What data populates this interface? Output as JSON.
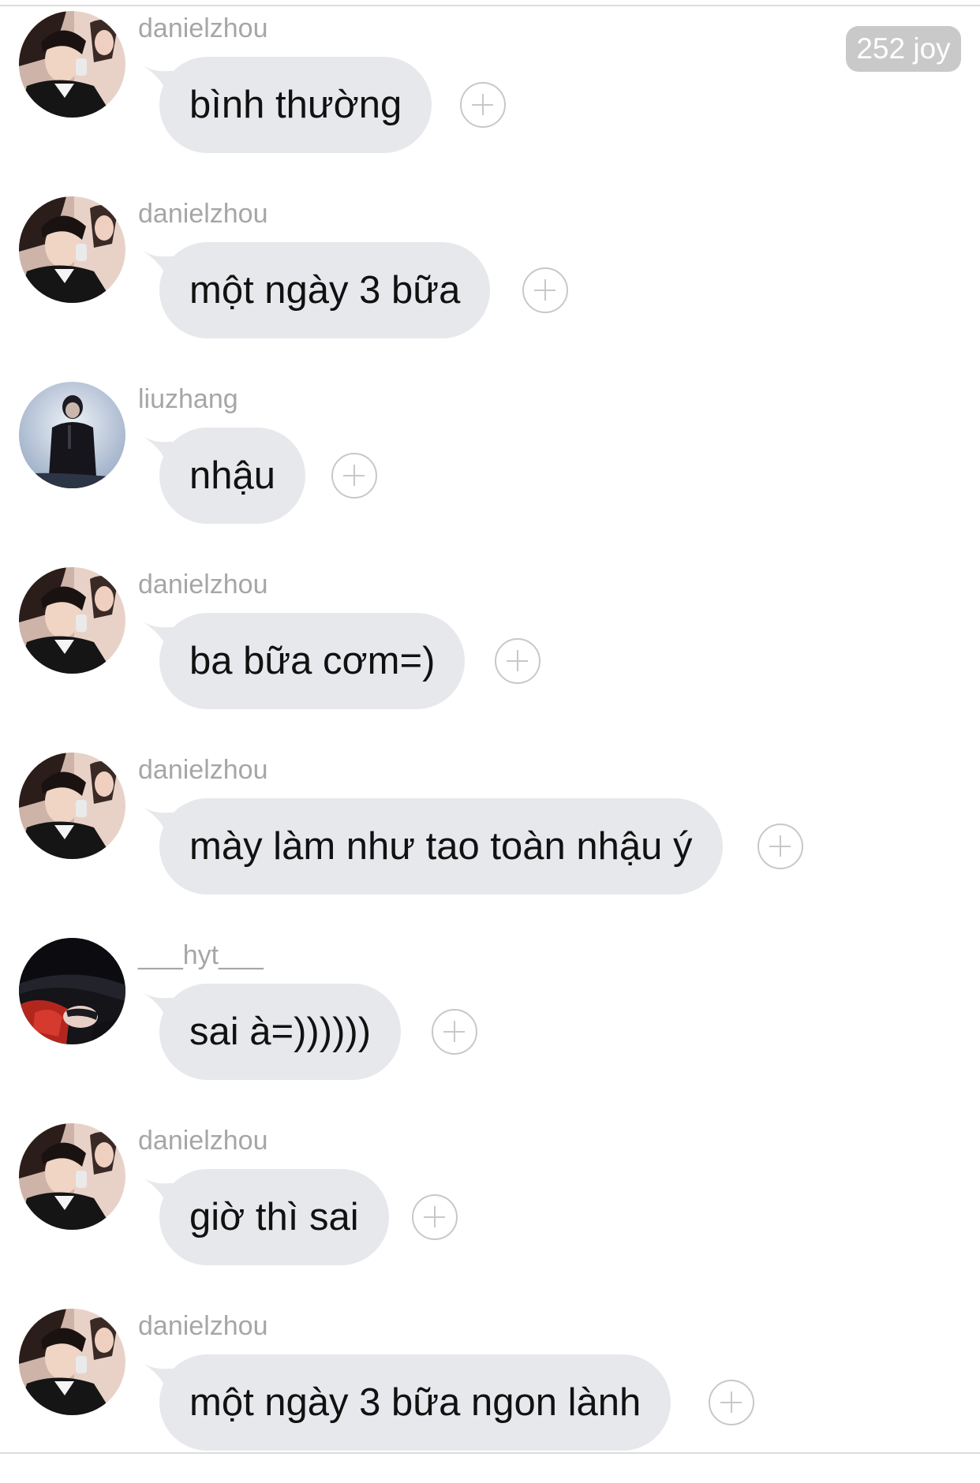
{
  "badge": {
    "label": "252 joy"
  },
  "colors": {
    "bubble": "#e6e8eb",
    "username": "#a6a6a6",
    "badge": "#c9c9c9",
    "react_button": "#c8c8c8"
  },
  "messages": [
    {
      "username": "danielzhou",
      "text": "bình thường",
      "avatar": "avatar-danielzhou"
    },
    {
      "username": "danielzhou",
      "text": "một ngày 3 bữa",
      "avatar": "avatar-danielzhou"
    },
    {
      "username": "liuzhang",
      "text": "nhậu",
      "avatar": "avatar-liuzhang"
    },
    {
      "username": "danielzhou",
      "text": "ba bữa cơm=)",
      "avatar": "avatar-danielzhou"
    },
    {
      "username": "danielzhou",
      "text": "mày làm như tao toàn nhậu ý",
      "avatar": "avatar-danielzhou"
    },
    {
      "username": "___hyt___",
      "text": "sai à=))))))",
      "avatar": "avatar-hyt"
    },
    {
      "username": "danielzhou",
      "text": "giờ thì sai",
      "avatar": "avatar-danielzhou"
    },
    {
      "username": "danielzhou",
      "text": "một ngày 3 bữa ngon lành",
      "avatar": "avatar-danielzhou"
    }
  ]
}
